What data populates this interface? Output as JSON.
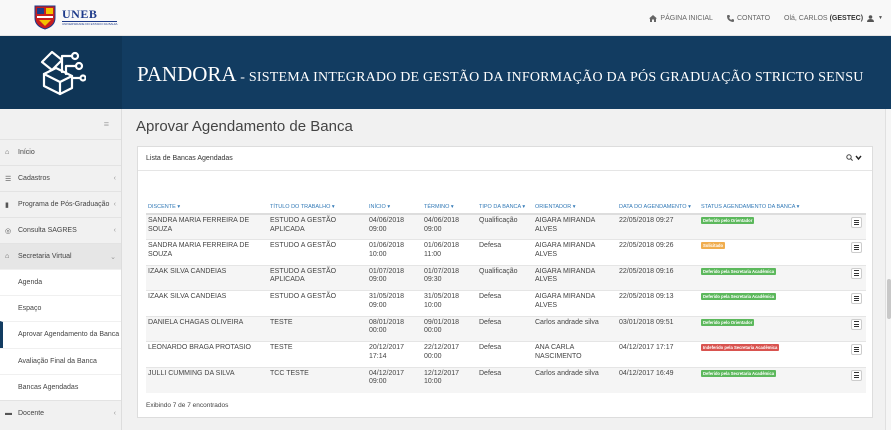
{
  "header": {
    "logo_text": "UNEB",
    "logo_subtext": "UNIVERSIDADE DO ESTADO DA BAHIA",
    "nav": {
      "home": "PÁGINA INICIAL",
      "contact": "CONTATO",
      "greeting": "Olá, CARLOS",
      "user_role": "(GESTEC)"
    },
    "banner_title_big": "PANDORA",
    "banner_title_rest": " - SISTEMA INTEGRADO DE GESTÃO DA INFORMAÇÃO DA PÓS GRADUAÇÃO STRICTO SENSU"
  },
  "sidebar": {
    "items": [
      {
        "label": "Início",
        "icon": "home-icon"
      },
      {
        "label": "Cadastros",
        "icon": "list-icon"
      },
      {
        "label": "Programa de Pós-Graduação",
        "icon": "book-icon"
      },
      {
        "label": "Consulta SAGRES",
        "icon": "circle-icon"
      },
      {
        "label": "Secretaria Virtual",
        "icon": "bank-icon"
      }
    ],
    "subitems": [
      {
        "label": "Agenda"
      },
      {
        "label": "Espaço"
      },
      {
        "label": "Aprovar Agendamento da Banca"
      },
      {
        "label": "Avaliação Final da Banca"
      },
      {
        "label": "Bancas Agendadas"
      }
    ],
    "last_item": {
      "label": "Docente",
      "icon": "briefcase-icon"
    }
  },
  "main": {
    "page_title": "Aprovar Agendamento de Banca",
    "panel_title": "Lista de Bancas Agendadas",
    "tools_icon": "search-icon",
    "columns": [
      "DISCENTE ▾",
      "TÍTULO DO TRABALHO ▾",
      "INÍCIO ▾",
      "TÉRMINO ▾",
      "TIPO DA BANCA ▾",
      "ORIENTADOR ▾",
      "DATA DO AGENDAMENTO ▾",
      "STATUS AGENDAMENTO DA BANCA ▾"
    ],
    "rows": [
      {
        "discente": "SANDRA MARIA FERREIRA DE SOUZA",
        "titulo": "ESTUDO A GESTÃO APLICADA",
        "inicio": "04/06/2018 09:00",
        "termino": "04/06/2018 09:00",
        "tipo": "Qualificação",
        "orientador": "AIGARA MIRANDA ALVES",
        "data": "22/05/2018 09:27",
        "status": "Deferido pelo Orientador",
        "status_color": "#5cb85c"
      },
      {
        "discente": "SANDRA MARIA FERREIRA DE SOUZA",
        "titulo": "ESTUDO A GESTÃO",
        "inicio": "01/06/2018 10:00",
        "termino": "01/06/2018 11:00",
        "tipo": "Defesa",
        "orientador": "AIGARA MIRANDA ALVES",
        "data": "22/05/2018 09:26",
        "status": "Solicitado",
        "status_color": "#f0ad4e"
      },
      {
        "discente": "IZAAK SILVA CANDEIAS",
        "titulo": "ESTUDO A GESTÃO APLICADA",
        "inicio": "01/07/2018 09:00",
        "termino": "01/07/2018 09:30",
        "tipo": "Qualificação",
        "orientador": "AIGARA MIRANDA ALVES",
        "data": "22/05/2018 09:16",
        "status": "Deferido pela Secretaria Acadêmica",
        "status_color": "#5cb85c"
      },
      {
        "discente": "IZAAK SILVA CANDEIAS",
        "titulo": "ESTUDO A GESTÃO",
        "inicio": "31/05/2018 09:00",
        "termino": "31/05/2018 10:00",
        "tipo": "Defesa",
        "orientador": "AIGARA MIRANDA ALVES",
        "data": "22/05/2018 09:13",
        "status": "Deferido pela Secretaria Acadêmica",
        "status_color": "#5cb85c"
      },
      {
        "discente": "DANIELA CHAGAS OLIVEIRA",
        "titulo": "TESTE",
        "inicio": "08/01/2018 00:00",
        "termino": "09/01/2018 00:00",
        "tipo": "Defesa",
        "orientador": "Carlos andrade silva",
        "data": "03/01/2018 09:51",
        "status": "Deferido pelo Orientador",
        "status_color": "#5cb85c"
      },
      {
        "discente": "LEONARDO BRAGA PROTASIO",
        "titulo": "TESTE",
        "inicio": "20/12/2017 17:14",
        "termino": "22/12/2017 00:00",
        "tipo": "Defesa",
        "orientador": "ANA CARLA NASCIMENTO",
        "data": "04/12/2017 17:17",
        "status": "Indeferido pela Secretaria Acadêmica",
        "status_color": "#d9534f"
      },
      {
        "discente": "JULLI CUMMING DA SILVA",
        "titulo": "TCC TESTE",
        "inicio": "04/12/2017 09:00",
        "termino": "12/12/2017 10:00",
        "tipo": "Defesa",
        "orientador": "Carlos andrade silva",
        "data": "04/12/2017 16:49",
        "status": "Deferido pela Secretaria Acadêmica",
        "status_color": "#5cb85c"
      }
    ],
    "footer": "Exibindo 7 de 7 encontrados",
    "row_menu_icon": "hamburger-menu-icon"
  }
}
